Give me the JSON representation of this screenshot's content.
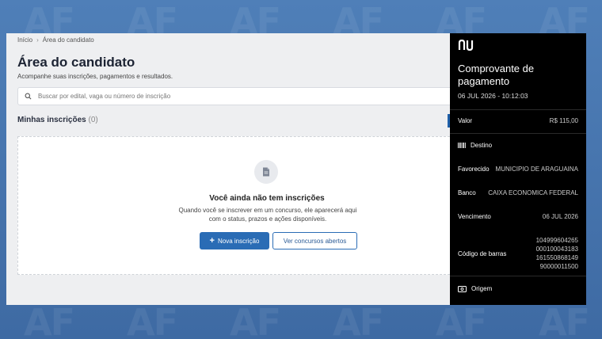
{
  "breadcrumb": {
    "home": "Início",
    "current": "Área do candidato"
  },
  "page": {
    "title": "Área do candidato",
    "subtitle": "Acompanhe suas inscrições, pagamentos e resultados."
  },
  "search": {
    "placeholder": "Buscar por edital, vaga ou número de inscrição",
    "value": ""
  },
  "section": {
    "title": "Minhas inscrições",
    "count": "(0)"
  },
  "empty": {
    "title": "Você ainda não tem inscrições",
    "desc_line1": "Quando você se inscrever em um concurso, ele aparecerá aqui",
    "desc_line2": "com o status, prazos e ações disponíveis.",
    "primary_label": "Nova inscrição",
    "secondary_label": "Ver concursos abertos",
    "icon": "document-icon"
  },
  "receipt": {
    "brand": "nu",
    "title": "Comprovante de pagamento",
    "datetime": "06 JUL 2026 - 10:12:03",
    "valor_label": "Valor",
    "valor": "R$ 115,00",
    "destino_label": "Destino",
    "favorecido_label": "Favorecido",
    "favorecido": "MUNICIPIO DE ARAGUAINA",
    "banco_label": "Banco",
    "banco": "CAIXA ECONOMICA FEDERAL",
    "vencimento_label": "Vencimento",
    "vencimento": "06 JUL 2026",
    "codigo_label": "Código de barras",
    "codigo": [
      "104999604265",
      "000100043183",
      "161550868149",
      "90000011500"
    ],
    "origem_label": "Origem"
  },
  "colors": {
    "accent": "#2a6cb5",
    "receipt_bg": "#000000",
    "page_bg": "#eeeff1"
  },
  "watermark": "AF"
}
